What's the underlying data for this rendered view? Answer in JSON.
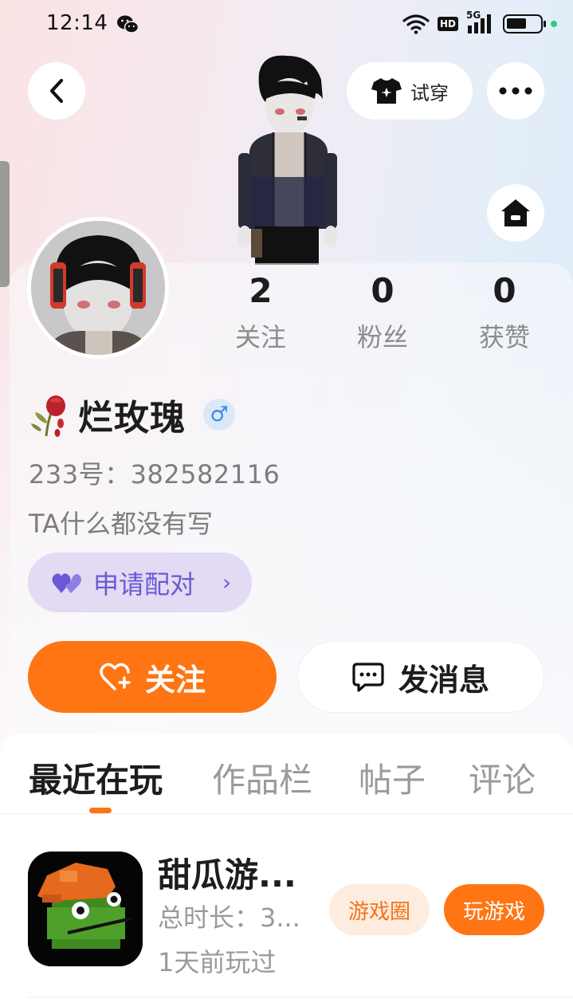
{
  "status_bar": {
    "time": "12:14",
    "hd_label": "HD",
    "network_label": "5G",
    "icons": [
      "wechat-icon",
      "wifi-icon",
      "signal-icon",
      "battery-icon"
    ]
  },
  "top_bar": {
    "try_on_label": "试穿",
    "icons": [
      "back-icon",
      "shirt-icon",
      "more-icon",
      "home-icon"
    ]
  },
  "profile": {
    "stats": [
      {
        "value": "2",
        "label": "关注"
      },
      {
        "value": "0",
        "label": "粉丝"
      },
      {
        "value": "0",
        "label": "获赞"
      }
    ],
    "name": "烂玫瑰",
    "gender_symbol": "♂",
    "uid_text": "233号：382582116",
    "bio": "TA什么都没有写",
    "pair_label": "申请配对",
    "pair_chevron": "›"
  },
  "actions": {
    "follow_label": "关注",
    "message_label": "发消息"
  },
  "tabs": [
    {
      "label": "最近在玩",
      "active": true
    },
    {
      "label": "作品栏",
      "active": false
    },
    {
      "label": "帖子",
      "active": false
    },
    {
      "label": "评论",
      "active": false
    }
  ],
  "recent_game": {
    "title": "甜瓜游...",
    "duration": "总时长：3...",
    "last_played": "1天前玩过",
    "circle_label": "游戏圈",
    "play_label": "玩游戏"
  },
  "colors": {
    "accent": "#ff7513",
    "pair_purple": "#6c58d4",
    "gender_blue": "#3a8be6"
  }
}
